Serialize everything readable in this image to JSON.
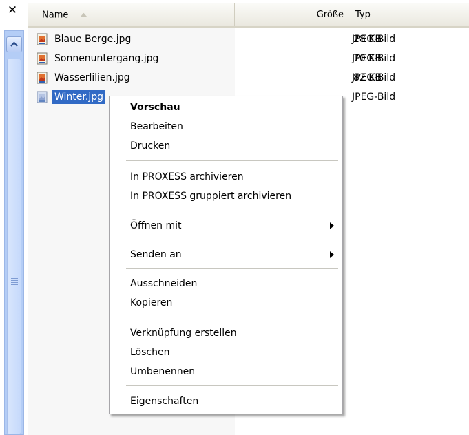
{
  "header": {
    "close_glyph": "✕",
    "columns": {
      "name": "Name",
      "size": "Größe",
      "type": "Typ"
    },
    "sort_column": "name",
    "sort_direction": "ascending"
  },
  "files": [
    {
      "name": "Blaue Berge.jpg",
      "size": "28 KB",
      "type": "JPEG-Bild",
      "icon": "jpeg-file-icon",
      "selected": false
    },
    {
      "name": "Sonnenuntergang.jpg",
      "size": "70 KB",
      "type": "JPEG-Bild",
      "icon": "jpeg-file-icon",
      "selected": false
    },
    {
      "name": "Wasserlilien.jpg",
      "size": "82 KB",
      "type": "JPEG-Bild",
      "icon": "jpeg-file-icon",
      "selected": false
    },
    {
      "name": "Winter.jpg",
      "size": "",
      "type": "JPEG-Bild",
      "icon": "jpeg-file-icon",
      "selected": true
    }
  ],
  "context_menu": {
    "items": [
      {
        "label": "Vorschau",
        "default": true
      },
      {
        "label": "Bearbeiten"
      },
      {
        "label": "Drucken"
      },
      {
        "label": "In PROXESS archivieren"
      },
      {
        "label": "In PROXESS gruppiert archivieren"
      },
      {
        "label": "Öffnen mit",
        "submenu": true
      },
      {
        "label": "Senden an",
        "submenu": true
      },
      {
        "label": "Ausschneiden"
      },
      {
        "label": "Kopieren"
      },
      {
        "label": "Verknüpfung erstellen"
      },
      {
        "label": "Löschen"
      },
      {
        "label": "Umbenennen"
      },
      {
        "label": "Eigenschaften"
      }
    ]
  },
  "colors": {
    "selection": "#316ac5",
    "scrollbar": "#b4cdf6",
    "header_bg": "#eae8df"
  }
}
